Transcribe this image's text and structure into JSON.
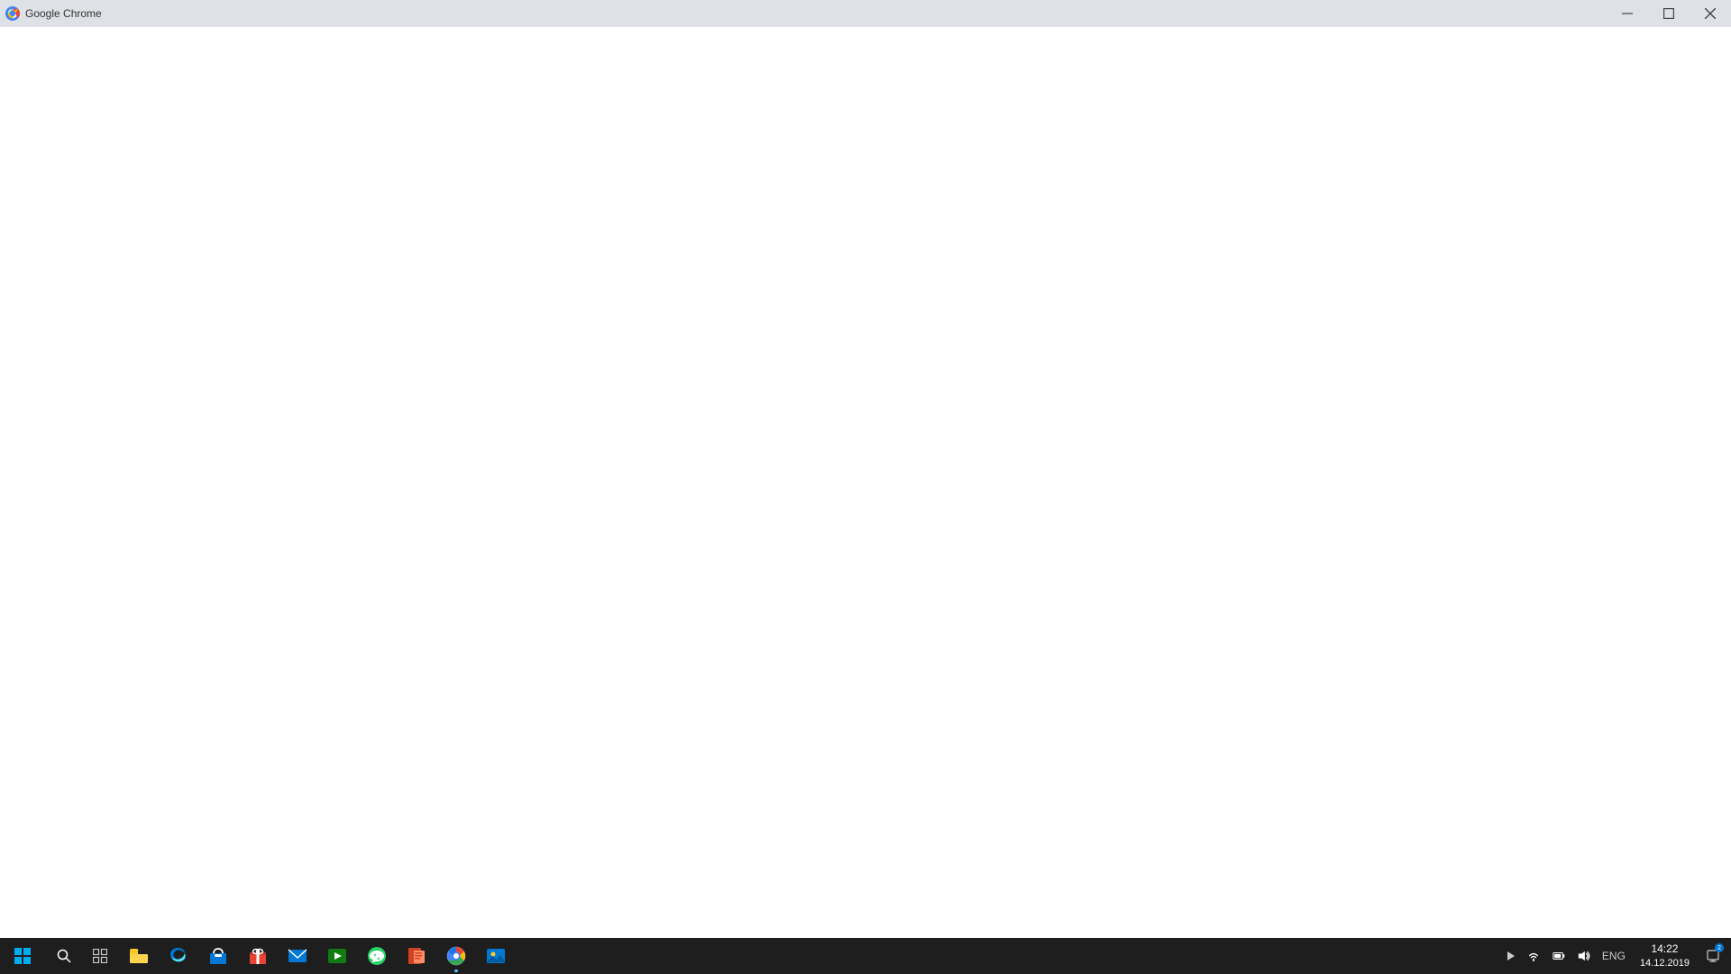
{
  "titlebar": {
    "title": "Google Chrome",
    "minimize_label": "Minimize",
    "maximize_label": "Maximize",
    "close_label": "Close"
  },
  "content": {
    "background": "#ffffff"
  },
  "taskbar": {
    "start_label": "Start",
    "search_label": "Search",
    "task_view_label": "Task View",
    "icons": [
      {
        "name": "file-explorer",
        "label": "File Explorer",
        "active": false
      },
      {
        "name": "edge",
        "label": "Microsoft Edge",
        "active": false
      },
      {
        "name": "store",
        "label": "Microsoft Store",
        "active": false
      },
      {
        "name": "gift",
        "label": "Gift / Promotion",
        "active": false
      },
      {
        "name": "mail",
        "label": "Mail",
        "active": false
      },
      {
        "name": "media",
        "label": "Media / Video",
        "active": false
      },
      {
        "name": "whatsapp",
        "label": "WhatsApp",
        "active": false
      },
      {
        "name": "powerpoint",
        "label": "PowerPoint",
        "active": false
      },
      {
        "name": "chrome",
        "label": "Google Chrome",
        "active": true
      },
      {
        "name": "photos",
        "label": "Photos",
        "active": false
      }
    ],
    "tray": {
      "expand_label": "Show hidden icons",
      "wifi_label": "Network",
      "battery_label": "Battery",
      "volume_label": "Volume",
      "language": "ENG"
    },
    "clock": {
      "time": "14:22",
      "date": "14.12.2019"
    },
    "notification_label": "Notifications",
    "notification_count": "2"
  }
}
